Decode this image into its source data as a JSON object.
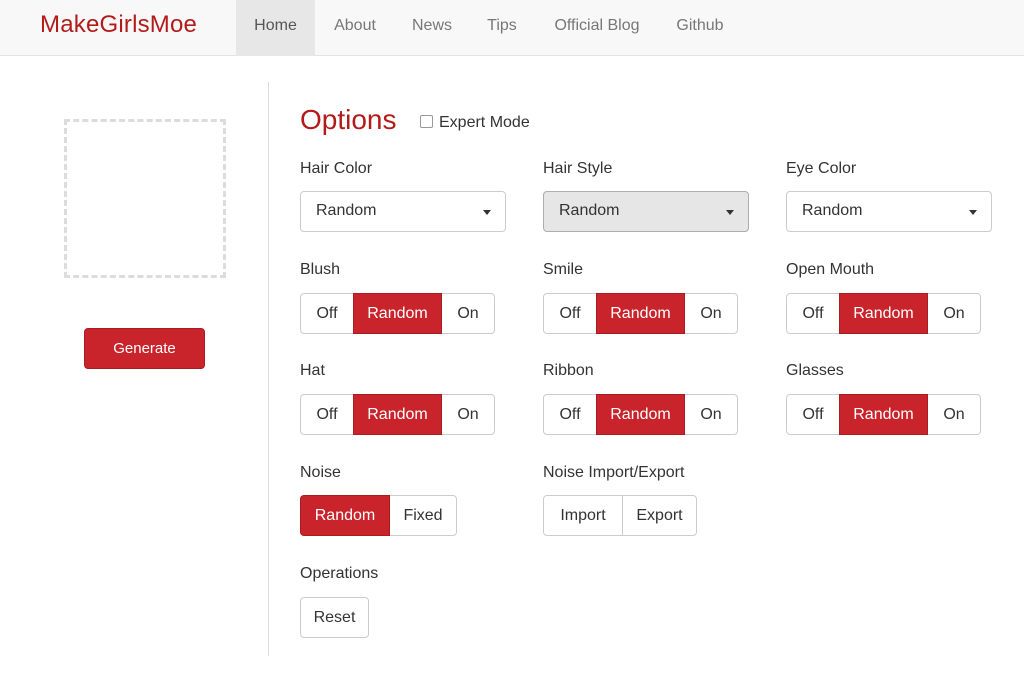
{
  "brand": "MakeGirlsMoe",
  "nav": [
    "Home",
    "About",
    "News",
    "Tips",
    "Official Blog",
    "Github"
  ],
  "generate_label": "Generate",
  "options_title": "Options",
  "expert_mode_label": "Expert Mode",
  "selects": [
    {
      "label": "Hair Color",
      "value": "Random"
    },
    {
      "label": "Hair Style",
      "value": "Random"
    },
    {
      "label": "Eye Color",
      "value": "Random"
    }
  ],
  "toggles": [
    {
      "label": "Blush",
      "options": [
        "Off",
        "Random",
        "On"
      ],
      "selected": "Random"
    },
    {
      "label": "Smile",
      "options": [
        "Off",
        "Random",
        "On"
      ],
      "selected": "Random"
    },
    {
      "label": "Open Mouth",
      "options": [
        "Off",
        "Random",
        "On"
      ],
      "selected": "Random"
    },
    {
      "label": "Hat",
      "options": [
        "Off",
        "Random",
        "On"
      ],
      "selected": "Random"
    },
    {
      "label": "Ribbon",
      "options": [
        "Off",
        "Random",
        "On"
      ],
      "selected": "Random"
    },
    {
      "label": "Glasses",
      "options": [
        "Off",
        "Random",
        "On"
      ],
      "selected": "Random"
    }
  ],
  "noise": {
    "label": "Noise",
    "options": [
      "Random",
      "Fixed"
    ],
    "selected": "Random"
  },
  "noise_io": {
    "label": "Noise Import/Export",
    "import": "Import",
    "export": "Export"
  },
  "operations": {
    "label": "Operations",
    "reset": "Reset"
  },
  "colors": {
    "accent": "#c9242b",
    "brand": "#b31b1b"
  }
}
